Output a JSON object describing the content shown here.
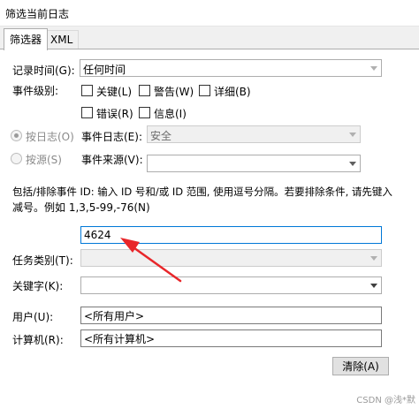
{
  "window": {
    "title": "筛选当前日志"
  },
  "tabs": [
    {
      "label": "筛选器",
      "active": true
    },
    {
      "label": "XML",
      "active": false
    }
  ],
  "record_time": {
    "label": "记录时间(G):",
    "value": "任何时间"
  },
  "event_level": {
    "label": "事件级别:",
    "options": [
      {
        "label": "关键(L)",
        "checked": false
      },
      {
        "label": "警告(W)",
        "checked": false
      },
      {
        "label": "详细(B)",
        "checked": false
      },
      {
        "label": "错误(R)",
        "checked": false
      },
      {
        "label": "信息(I)",
        "checked": false
      }
    ]
  },
  "by_log": {
    "radio_label": "按日志(O)",
    "label": "事件日志(E):",
    "value": "安全"
  },
  "by_source": {
    "radio_label": "按源(S)",
    "label": "事件来源(V):",
    "value": ""
  },
  "event_id": {
    "description_line1": "包括/排除事件 ID: 输入 ID 号和/或 ID 范围, 使用逗号分隔。若要排除条件, 请先键入",
    "description_line2": "减号。例如 1,3,5-99,-76(N)",
    "value": "4624"
  },
  "task_category": {
    "label": "任务类别(T):",
    "value": ""
  },
  "keywords": {
    "label": "关键字(K):",
    "value": ""
  },
  "user": {
    "label": "用户(U):",
    "value": "<所有用户>"
  },
  "computer": {
    "label": "计算机(R):",
    "value": "<所有计算机>"
  },
  "clear_button": {
    "label": "清除(A)"
  },
  "watermark": "CSDN @浅*默",
  "colors": {
    "accent": "#0078d7",
    "annotation_arrow": "#e8262a"
  },
  "icons": {
    "dropdown": "chevron-down-icon",
    "annotation": "red-arrow-icon"
  }
}
